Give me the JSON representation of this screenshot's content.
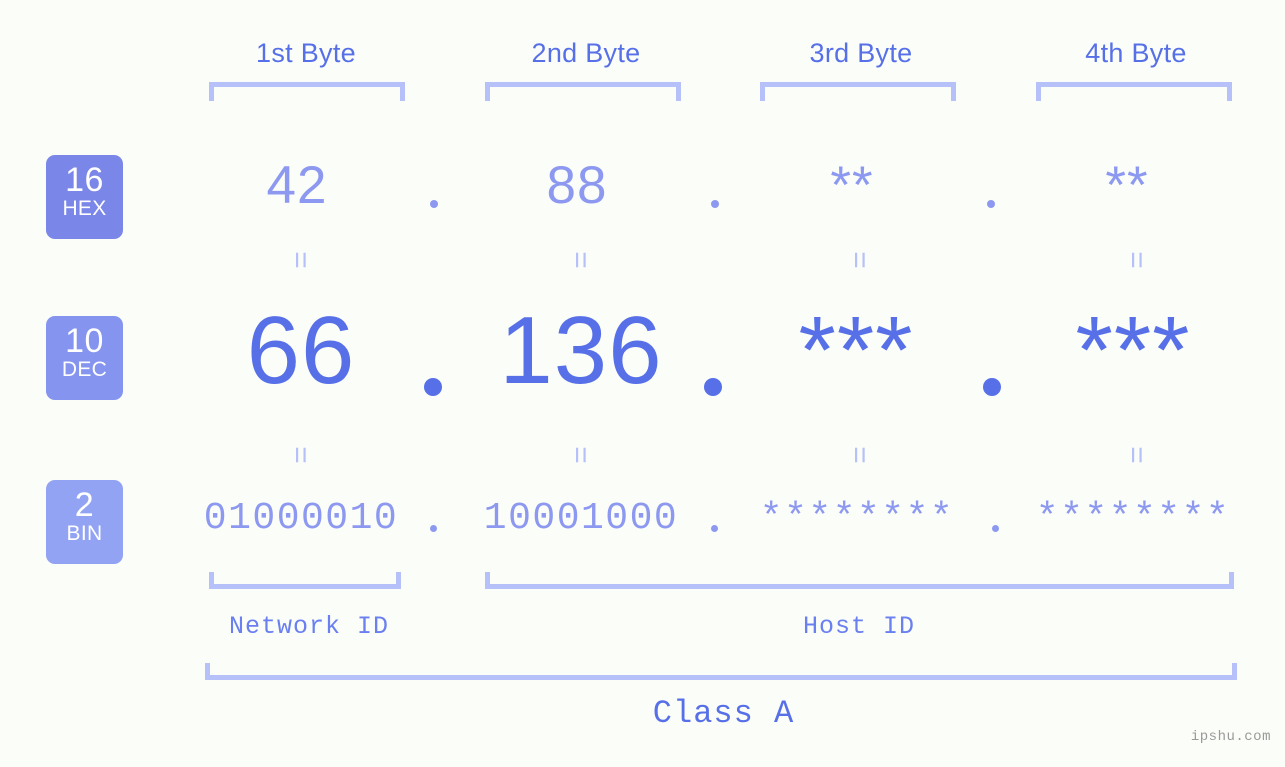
{
  "watermark": "ipshu.com",
  "background_color": "#fbfdf8",
  "accent_color": "#5770e8",
  "muted_accent_color": "#8d99f0",
  "bracket_color": "#b6c0f9",
  "byte_headers": [
    {
      "label": "1st Byte"
    },
    {
      "label": "2nd Byte"
    },
    {
      "label": "3rd Byte"
    },
    {
      "label": "4th Byte"
    }
  ],
  "bases": [
    {
      "number": "16",
      "abbr": "HEX",
      "color": "#7a86e8"
    },
    {
      "number": "10",
      "abbr": "DEC",
      "color": "#8494ef"
    },
    {
      "number": "2",
      "abbr": "BIN",
      "color": "#92a3f3"
    }
  ],
  "rows": {
    "hex": {
      "values": [
        "42",
        "88",
        "**",
        "**"
      ]
    },
    "dec": {
      "values": [
        "66",
        "136",
        "***",
        "***"
      ]
    },
    "bin": {
      "values": [
        "01000010",
        "10001000",
        "********",
        "********"
      ]
    }
  },
  "separator": ".",
  "equals_sign": "=",
  "segments": [
    {
      "label": "Network ID"
    },
    {
      "label": "Host ID"
    }
  ],
  "class_label": "Class A"
}
